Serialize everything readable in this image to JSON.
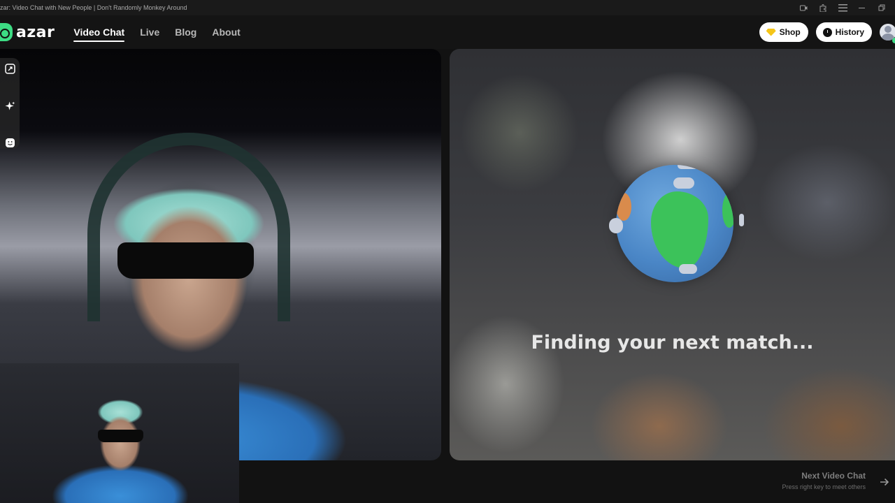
{
  "window": {
    "title": "zar: Video Chat with New People | Don't Randomly Monkey Around",
    "controls": [
      "camera-icon",
      "extension-icon",
      "menu-icon",
      "minimize-icon",
      "restore-icon"
    ]
  },
  "navbar": {
    "logo_text": "azar",
    "links": [
      {
        "label": "Video Chat",
        "active": true
      },
      {
        "label": "Live",
        "active": false
      },
      {
        "label": "Blog",
        "active": false
      },
      {
        "label": "About",
        "active": false
      }
    ],
    "shop_label": "Shop",
    "history_label": "History"
  },
  "side_tools": [
    "resize-icon",
    "sparkle-icon",
    "emoji-icon"
  ],
  "match_panel": {
    "status_text": "Finding your next match..."
  },
  "next": {
    "title": "Next Video Chat",
    "subtitle": "Press right key to meet others"
  },
  "colors": {
    "brand_green": "#3ddc84",
    "background": "#121212",
    "gem_yellow": "#f5c518"
  }
}
